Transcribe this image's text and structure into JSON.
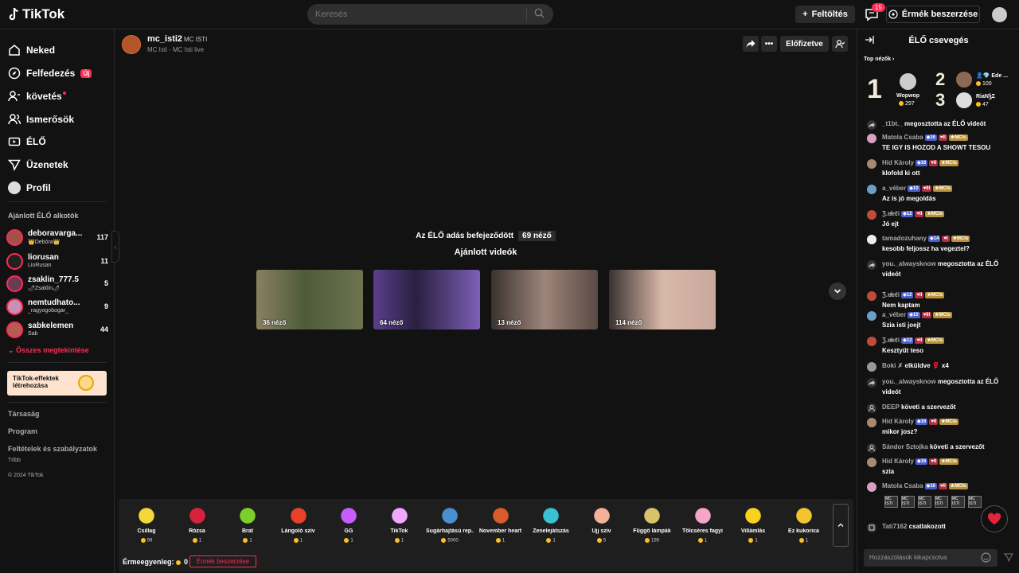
{
  "topbar": {
    "logo": "TikTok",
    "search_placeholder": "Keresés",
    "upload": "Feltöltés",
    "inbox_badge": "15",
    "get_coins": "Érmék beszerzése"
  },
  "sidebar": {
    "nav": [
      {
        "label": "Neked",
        "icon": "home-icon"
      },
      {
        "label": "Felfedezés",
        "icon": "compass-icon",
        "badge": "Új"
      },
      {
        "label": "követés",
        "icon": "following-icon"
      },
      {
        "label": "Ismerősök",
        "icon": "friends-icon"
      },
      {
        "label": "ÉLŐ",
        "icon": "live-icon"
      },
      {
        "label": "Üzenetek",
        "icon": "send-icon"
      },
      {
        "label": "Profil",
        "icon": "profile-avatar"
      }
    ],
    "creators_title": "Ajánlott ÉLŐ alkotók",
    "creators": [
      {
        "name": "deboravarga...",
        "sub": "👑Debóra👑",
        "count": "117"
      },
      {
        "name": "liorusan",
        "sub": "LioRusan",
        "count": "11"
      },
      {
        "name": "zsaklin_777.5",
        "sub": "🌶Zsaklin🌶",
        "count": "5"
      },
      {
        "name": "nemtudhato...",
        "sub": "_ragyogobogar_",
        "count": "9"
      },
      {
        "name": "sabkelemen",
        "sub": "Sab",
        "count": "44"
      }
    ],
    "see_all": "Összes megtekintése",
    "effects_banner": "TikTok-effektek létrehozása",
    "footer": [
      "Társaság",
      "Program",
      "Feltételek és szabályzatok"
    ],
    "more": "Több",
    "copyright": "© 2024 TikTok"
  },
  "stream": {
    "username": "mc_isti2",
    "tag": "MC ISTI",
    "subtitle": "MC Isti - MC Isti live",
    "subscribed": "Előfizetve",
    "ended_text": "Az ÉLŐ adás befejeződött",
    "ended_viewers": "69 néző",
    "recommended_title": "Ajánlott videók",
    "videos": [
      {
        "viewers": "36 néző",
        "color": "#5b6247"
      },
      {
        "viewers": "64 néző",
        "color": "#3a2a5f"
      },
      {
        "viewers": "13 néző",
        "color": "#4c3e38"
      },
      {
        "viewers": "114 néző",
        "color": "#a58a80"
      }
    ]
  },
  "gifts": [
    {
      "name": "Csillag",
      "price": "99",
      "color": "#f4d73a"
    },
    {
      "name": "Rózsa",
      "price": "1",
      "color": "#d6223a"
    },
    {
      "name": "Brat",
      "price": "1",
      "color": "#7bcf2a"
    },
    {
      "name": "Lángoló szív",
      "price": "1",
      "color": "#e8412c"
    },
    {
      "name": "GG",
      "price": "1",
      "color": "#c65dff"
    },
    {
      "name": "TikTok",
      "price": "1",
      "color": "#f0a8ff"
    },
    {
      "name": "Sugárhajtású rep...",
      "price": "5000",
      "color": "#4a8fd0"
    },
    {
      "name": "November heart",
      "price": "1",
      "color": "#d95a2a"
    },
    {
      "name": "Zenelejátszás",
      "price": "1",
      "color": "#39c2d6"
    },
    {
      "name": "Ujj szív",
      "price": "5",
      "color": "#f5b09a"
    },
    {
      "name": "Függő lámpák",
      "price": "199",
      "color": "#d8c36a"
    },
    {
      "name": "Tölcséres fagyi",
      "price": "1",
      "color": "#f5a5c8"
    },
    {
      "name": "Villámlás",
      "price": "1",
      "color": "#f7d21e"
    },
    {
      "name": "Ez kukorica",
      "price": "1",
      "color": "#f2c52f"
    }
  ],
  "balance_label": "Érmeegyenleg:",
  "balance_value": "0",
  "buy_coins": "Érmék beszerzése",
  "chat": {
    "title": "ÉLŐ csevegés",
    "top_viewers_label": "Top nézők",
    "top": [
      {
        "rank": "1",
        "name": "Wopwop",
        "points": "297"
      },
      {
        "rank": "2",
        "name": "Ede",
        "points": "100"
      },
      {
        "rank": "3",
        "name": "RiaN",
        "points": "47"
      }
    ],
    "messages": [
      {
        "user": "_t1bt._",
        "text": "megosztotta az ÉLŐ videót",
        "share": true
      },
      {
        "user": "Matola Csaba",
        "badges": [
          "16",
          "II",
          "MCIs"
        ],
        "line2": "TE IGY IS HOZOD A SHOWT TESOU"
      },
      {
        "user": "Híd Károly",
        "badges": [
          "16",
          "II",
          "MCIs"
        ],
        "line2": "klofold ki ott"
      },
      {
        "user": "a_véber",
        "badges": [
          "10",
          "III",
          "MCIs"
        ],
        "line2": "Az is jó megoldás"
      },
      {
        "user": "Ʒ.ɐ̸ɐℓi",
        "badges": [
          "12",
          "II",
          "MCIs"
        ],
        "line2": "Jó ejt"
      },
      {
        "user": "tamadozuhany",
        "badges": [
          "14",
          "I",
          "MCIs"
        ],
        "line2": "kesobb feljossz ha vegeztel?"
      },
      {
        "user": "you._alwaysknow",
        "text": "megosztotta az ÉLŐ",
        "line2": "videót",
        "share": true
      },
      {
        "user": "Ʒ.ɐ̸ɐℓi",
        "badges": [
          "12",
          "II",
          "MCIs"
        ],
        "line2": "Nem kaptam"
      },
      {
        "user": "a_véber",
        "badges": [
          "10",
          "III",
          "MCIs"
        ],
        "line2": "Szia isti joejt"
      },
      {
        "user": "Ʒ.ɐ̸ɐℓi",
        "badges": [
          "12",
          "II",
          "MCIs"
        ],
        "line2": "Kesztyűt teso"
      },
      {
        "user": "Boki ✗",
        "text": "elküldve 🌹 x4"
      },
      {
        "user": "you._alwaysknow",
        "text": "megosztotta az ÉLŐ",
        "line2": "videót",
        "share": true
      },
      {
        "user": "DEEP",
        "text": "követi a szervezőt",
        "follow": true
      },
      {
        "user": "Híd Károly",
        "badges": [
          "16",
          "II",
          "MCIs"
        ],
        "line2": "mikor josz?"
      },
      {
        "user": "Sándor Sztojka",
        "text": "követi a szervezőt",
        "follow": true
      },
      {
        "user": "Híd Károly",
        "badges": [
          "16",
          "II",
          "MCIs"
        ],
        "line2": "szia"
      },
      {
        "user": "Matola Csaba",
        "badges": [
          "16",
          "II",
          "MCIs"
        ]
      },
      {
        "user": "Tati7162",
        "text": "csatlakozott",
        "join": true
      }
    ],
    "gift_row_label": "MC ISTI",
    "input_placeholder": "Hozzászólások kikapcsolva"
  }
}
